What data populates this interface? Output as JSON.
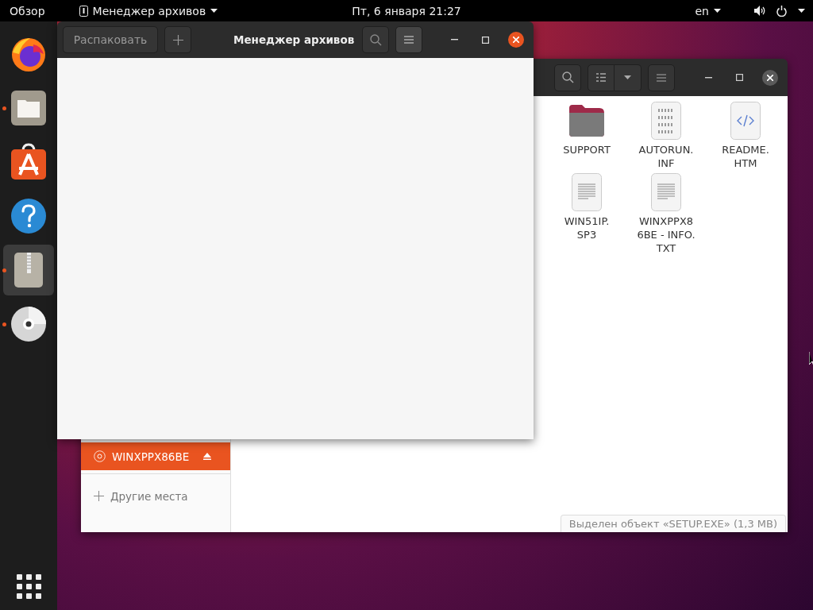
{
  "top_bar": {
    "activities": "Обзор",
    "app_menu": "Менеджер архивов",
    "clock": "Пт, 6 января  21:27",
    "language": "en"
  },
  "dock": {
    "items": [
      {
        "kind": "browser",
        "running": false,
        "selected": false
      },
      {
        "kind": "files",
        "running": true,
        "selected": false
      },
      {
        "kind": "store",
        "running": false,
        "selected": false
      },
      {
        "kind": "help",
        "running": false,
        "selected": false
      },
      {
        "kind": "archive",
        "running": true,
        "selected": true
      },
      {
        "kind": "disc",
        "running": true,
        "selected": false
      }
    ]
  },
  "archive_window": {
    "extract_button": "Распаковать",
    "title": "Менеджер архивов"
  },
  "files_window": {
    "sidebar": {
      "items": [
        {
          "kind": "drive",
          "label": "WINXPPX86BE",
          "selected": true
        },
        {
          "kind": "other",
          "label": "Другие места",
          "selected": false
        }
      ]
    },
    "files": [
      {
        "kind": "folder",
        "lines": [
          "SUPPORT"
        ]
      },
      {
        "kind": "binary",
        "lines": [
          "AUTORUN.",
          "INF"
        ]
      },
      {
        "kind": "html",
        "lines": [
          "README.",
          "HTM"
        ]
      },
      {
        "kind": "text",
        "lines": [
          "WIN51IP.",
          "SP3"
        ]
      },
      {
        "kind": "text",
        "lines": [
          "WINXPPX8",
          "6BE - INFO.",
          "TXT"
        ]
      }
    ],
    "status": "Выделен объект «SETUP.EXE» (1,3 MB)"
  }
}
